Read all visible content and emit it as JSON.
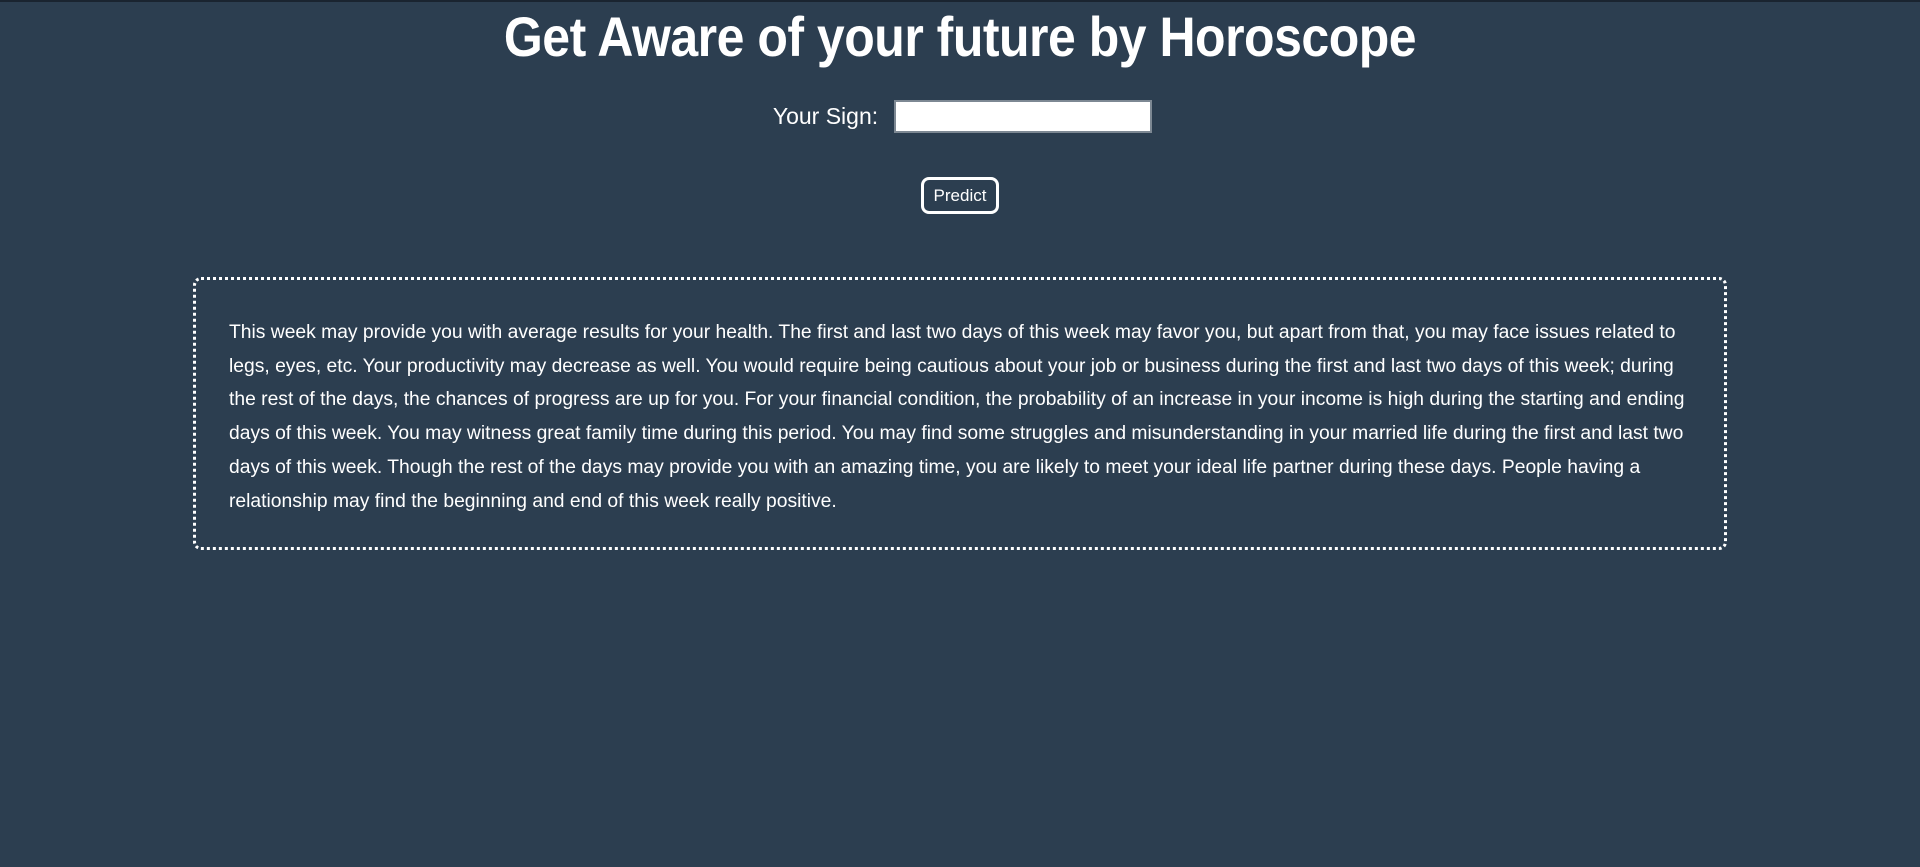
{
  "header": {
    "title": "Get Aware of your future by Horoscope"
  },
  "form": {
    "sign_label": "Your Sign:",
    "sign_value": "",
    "predict_label": "Predict"
  },
  "result": {
    "text": "This week may provide you with average results for your health. The first and last two days of this week may favor you, but apart from that, you may face issues related to legs, eyes, etc. Your productivity may decrease as well. You would require being cautious about your job or business during the first and last two days of this week; during the rest of the days, the chances of progress are up for you. For your financial condition, the probability of an increase in your income is high during the starting and ending days of this week. You may witness great family time during this period. You may find some struggles and misunderstanding in your married life during the first and last two days of this week. Though the rest of the days may provide you with an amazing time, you are likely to meet your ideal life partner during these days. People having a relationship may find the beginning and end of this week really positive."
  },
  "colors": {
    "background": "#2c3e50",
    "text": "#ffffff",
    "input_border": "#7d8893"
  }
}
